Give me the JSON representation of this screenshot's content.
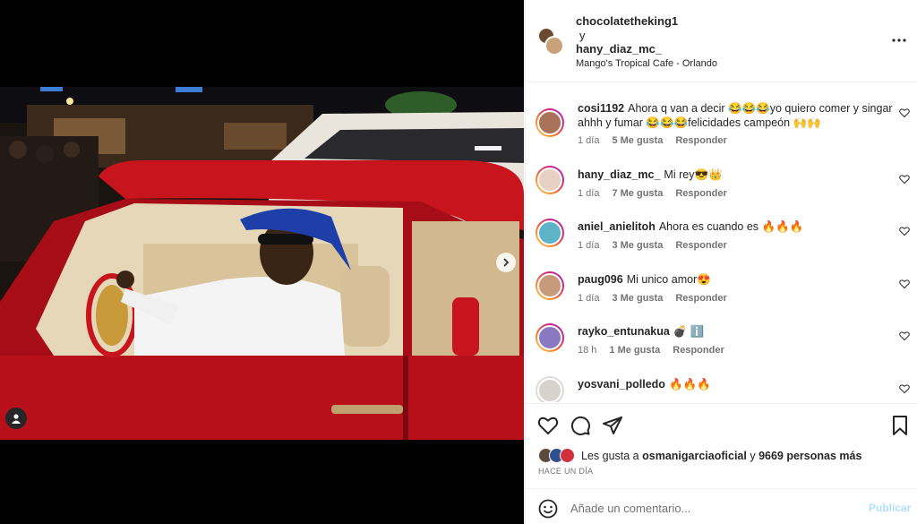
{
  "post": {
    "authors": [
      "chocolatetheking1",
      "hany_diaz_mc_"
    ],
    "author_joiner": "y",
    "location": "Mango's Tropical Cafe - Orlando"
  },
  "comments": [
    {
      "user": "cosi1192",
      "text": "Ahora q van a decir 😂😂😂yo quiero comer y singar ahhh y fumar 😂😂😂felicidades campeón 🙌🙌",
      "time": "1 día",
      "likes": "5 Me gusta",
      "reply": "Responder"
    },
    {
      "user": "hany_diaz_mc_",
      "text": "Mi rey😎👑",
      "time": "1 día",
      "likes": "7 Me gusta",
      "reply": "Responder"
    },
    {
      "user": "aniel_anielitoh",
      "text": "Ahora es cuando es 🔥🔥🔥",
      "time": "1 día",
      "likes": "3 Me gusta",
      "reply": "Responder"
    },
    {
      "user": "paug096",
      "text": "Mi unico amor😍",
      "time": "1 día",
      "likes": "3 Me gusta",
      "reply": "Responder"
    },
    {
      "user": "rayko_entunakua",
      "text": "💣 ℹ️",
      "time": "18 h",
      "likes": "1 Me gusta",
      "reply": "Responder"
    },
    {
      "user": "yosvani_polledo",
      "text": "🔥🔥🔥",
      "time": "",
      "likes": "",
      "reply": ""
    }
  ],
  "likes": {
    "prefix": "Les gusta a",
    "user": "osmanigarciaoficial",
    "joiner": "y",
    "others": "9669 personas más"
  },
  "date": "HACE UN DÍA",
  "composer": {
    "placeholder": "Añade un comentario...",
    "publish_label": "Publicar"
  },
  "icons": {
    "user_tag": "person-tag-icon",
    "next": "chevron-right-icon",
    "more": "more-horizontal-icon",
    "heart": "heart-outline-icon",
    "comment": "comment-bubble-icon",
    "share": "paper-plane-icon",
    "save": "bookmark-icon",
    "emoji": "smiley-icon"
  },
  "colors": {
    "text": "#262626",
    "secondary": "#737373",
    "publish_disabled": "#b2dffc",
    "car_red": "#c8141c",
    "hat_blue": "#1f3fa8"
  }
}
